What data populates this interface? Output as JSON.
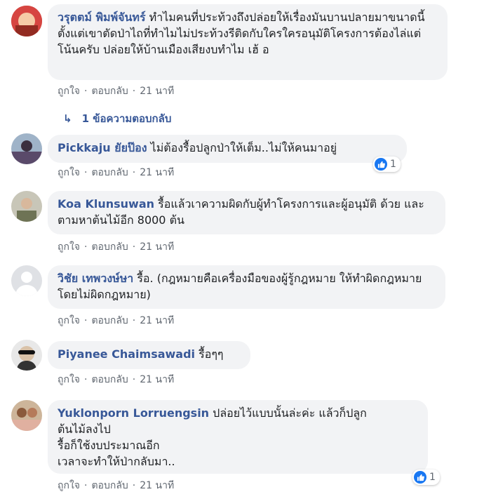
{
  "comments": [
    {
      "author": "วรุตตม์ พิมพ์จันทร์",
      "text": "ทำไมคนที่ประท้วงถึงปล่อยให้เรื่องมันบานปลายมาขนาดนี้ตั้งแต่เขาตัดป่าไถที่ทำไมไม่ประท้วงรีติดกับใครใครอนุมัติโครงการต้องไล่แต่โน้นครับ ปล่อยให้บ้านเมืองเสียงบทำไม เฮ้ อ",
      "like": "ถูกใจ",
      "reply": "ตอบกลับ",
      "time": "21 นาที",
      "avatar_color": "#c0392b"
    },
    {
      "author": "Pickkaju ยัยป๊อง",
      "text": "ไม่ต้องรื้อปลูกป่าให้เต็ม..ไม่ให้คนมาอยู่",
      "like": "ถูกใจ",
      "reply": "ตอบกลับ",
      "time": "21 นาที",
      "reactions": "1",
      "avatar_color": "#7d6b8c"
    },
    {
      "author": "Koa Klunsuwan",
      "text": "รื้อแล้วเาความผิดกับผู้ทำโครงการและผู้อนุมัติ ด้วย และตามหาต้นไม้อีก 8000 ต้น",
      "like": "ถูกใจ",
      "reply": "ตอบกลับ",
      "time": "21 นาที",
      "avatar_color": "#8a8f7a"
    },
    {
      "author": "วิชัย เทพวงษ์ษา",
      "text": "รื้อ. (กฎหมายคือเครื่องมือของผู้รู้กฎหมาย ให้ทำผิดกฎหมาย โดยไม่ผิดกฎหมาย)",
      "like": "ถูกใจ",
      "reply": "ตอบกลับ",
      "time": "21 นาที",
      "avatar_color": "#c4c7cc"
    },
    {
      "author": "Piyanee Chaimsawadi",
      "text": "รื้อๆๆ",
      "like": "ถูกใจ",
      "reply": "ตอบกลับ",
      "time": "21 นาที",
      "avatar_color": "#4a4a4a"
    },
    {
      "author": "Yuklonporn Lorruengsin",
      "text_lines": [
        "ปล่อยไว้แบบนั้นล่ะค่ะ แล้วก็ปลูก",
        "ต้นไม้ลงไป",
        "รื้อก็ใช้งบประมาณอีก",
        "เวลาจะทำให้ป่ากลับมา.."
      ],
      "like": "ถูกใจ",
      "reply": "ตอบกลับ",
      "time": "21 นาที",
      "reactions": "1",
      "avatar_color": "#b07a5a"
    }
  ],
  "replies_link": "1 ข้อความตอบกลับ",
  "colors": {
    "author": "#385898",
    "bubble": "#f2f3f5",
    "meta": "#606770",
    "like": "#1877f2"
  }
}
